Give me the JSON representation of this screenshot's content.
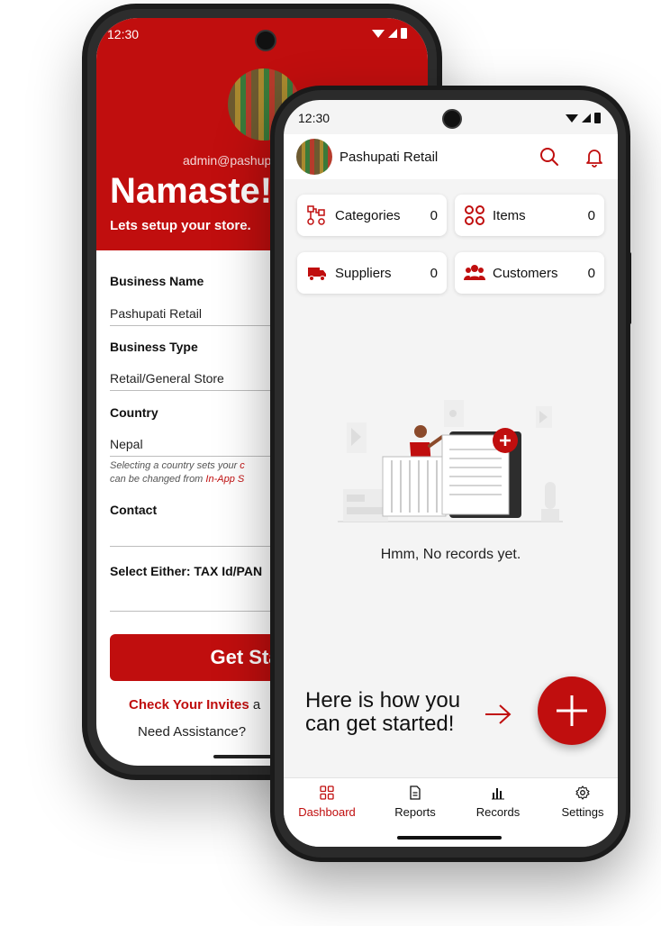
{
  "back_screen": {
    "time": "12:30",
    "email": "admin@pashup",
    "greeting": "Namaste!",
    "subtitle": "Lets setup your store.",
    "fields": {
      "business_name_label": "Business Name",
      "business_name_value": "Pashupati Retail",
      "business_type_label": "Business Type",
      "business_type_value": "Retail/General Store",
      "country_label": "Country",
      "country_value": "Nepal",
      "country_note_1": "Selecting a country sets your ",
      "country_note_1_red": "c",
      "country_note_2": "can be changed from ",
      "country_note_2_red": "In-App S",
      "contact_label": "Contact",
      "tax_label": "Select Either: TAX Id/PAN"
    },
    "cta_label": "Get Sta",
    "invite_text": "Check Your Invites",
    "invite_tail": " a",
    "help_text": "Need Assistance?"
  },
  "front_screen": {
    "time": "12:30",
    "store_name": "Pashupati Retail",
    "cards": [
      {
        "label": "Categories",
        "count": "0",
        "icon": "categories-icon"
      },
      {
        "label": "Items",
        "count": "0",
        "icon": "items-icon"
      },
      {
        "label": "Suppliers",
        "count": "0",
        "icon": "truck-icon"
      },
      {
        "label": "Customers",
        "count": "0",
        "icon": "customers-icon"
      }
    ],
    "empty_message": "Hmm, No records yet.",
    "howto_line1": "Here is how you",
    "howto_line2": "can get started!",
    "nav": [
      {
        "label": "Dashboard",
        "icon": "dashboard-icon",
        "active": true
      },
      {
        "label": "Reports",
        "icon": "reports-icon",
        "active": false
      },
      {
        "label": "Records",
        "icon": "records-icon",
        "active": false
      },
      {
        "label": "Settings",
        "icon": "settings-icon",
        "active": false
      }
    ]
  },
  "colors": {
    "brand_red": "#c00e0e",
    "background": "#f4f4f4"
  }
}
